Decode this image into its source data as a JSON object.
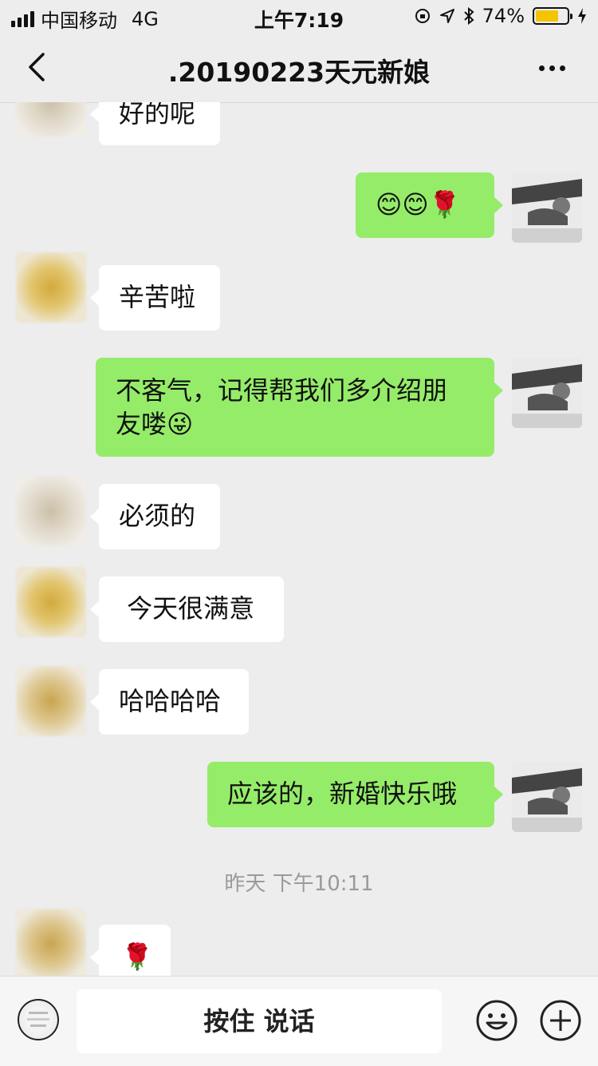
{
  "status_bar": {
    "carrier": "中国移动",
    "network": "4G",
    "time": "上午7:19",
    "battery_percent": "74%",
    "battery_level": 0.74
  },
  "nav": {
    "title": ".20190223天元新娘"
  },
  "messages": [
    {
      "side": "in",
      "text": "好的呢"
    },
    {
      "side": "out",
      "text": "😊😊🌹"
    },
    {
      "side": "in",
      "text": "辛苦啦"
    },
    {
      "side": "out",
      "line1": "不客气，记得帮我们多介绍朋",
      "line2": "友喽😜"
    },
    {
      "side": "in",
      "text": "必须的"
    },
    {
      "side": "in",
      "text": " 今天很满意"
    },
    {
      "side": "in",
      "text": "哈哈哈哈"
    },
    {
      "side": "out",
      "text": "应该的，新婚快乐哦"
    },
    {
      "side": "in",
      "text": "🌹"
    }
  ],
  "timestamp": "昨天 下午10:11",
  "input": {
    "hold_to_talk": "按住 说话"
  },
  "colors": {
    "background": "#ededed",
    "outgoing_bubble": "#95ec69",
    "incoming_bubble": "#ffffff",
    "battery": "#f5c400"
  }
}
